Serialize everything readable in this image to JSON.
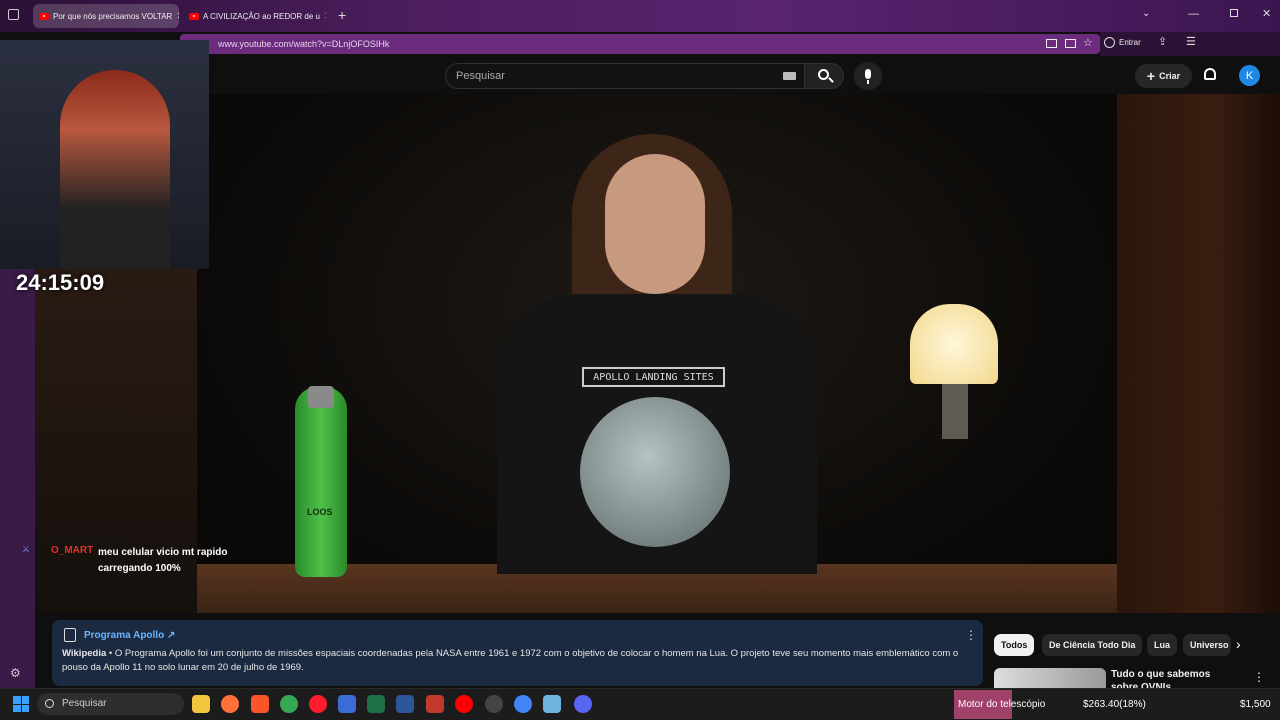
{
  "browser": {
    "tabs": [
      {
        "title": "Por que nós precisamos VOLTAR",
        "active": true
      },
      {
        "title": "A CIVILIZAÇÃO ao REDOR de u",
        "active": false
      }
    ],
    "new_tab": "+",
    "url": "www.youtube.com/watch?v=DLnjOFOSIHk",
    "signin_label": "Entrar"
  },
  "youtube": {
    "search_placeholder": "Pesquisar",
    "create_label": "Criar",
    "avatar_letter": "K"
  },
  "video": {
    "shirt_text": "APOLLO LANDING SITES",
    "bottle_text": "LOOS"
  },
  "stream": {
    "timer": "24:15:09",
    "chat": {
      "user": "O_MART",
      "message": "meu celular vicio mt rapido carregando 100%"
    }
  },
  "info_panel": {
    "title": "Programa Apollo",
    "source": "Wikipedia",
    "text": "O Programa Apollo foi um conjunto de missões espaciais coordenadas pela NASA entre 1961 e 1972 com o objetivo de colocar o homem na Lua. O projeto teve seu momento mais emblemático com o pouso da Apollo 11 no solo lunar em 20 de julho de 1969."
  },
  "chips": [
    "Todos",
    "De Ciência Todo Dia",
    "Lua",
    "Universo"
  ],
  "recommendation": {
    "title": "Tudo o que sabemos sobre OVNIs"
  },
  "taskbar": {
    "search_label": "Pesquisar",
    "stock_name": "Motor do telescópio",
    "stock_price": "$263.40(18%)",
    "stock_total": "$1,500"
  },
  "colors": {
    "accent": "#ff0000",
    "link": "#6cb4ff",
    "chat_user": "#e0302a",
    "avatar": "#1e88e5"
  }
}
